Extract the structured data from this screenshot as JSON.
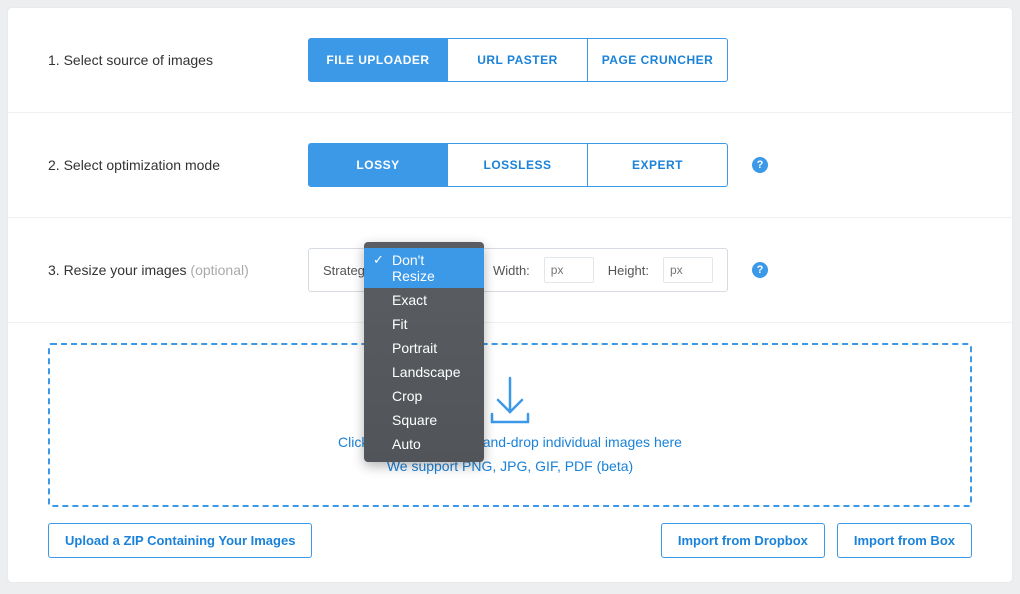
{
  "section1": {
    "label": "1. Select source of images",
    "tabs": [
      "FILE UPLOADER",
      "URL PASTER",
      "PAGE CRUNCHER"
    ],
    "active": 0
  },
  "section2": {
    "label": "2. Select optimization mode",
    "tabs": [
      "LOSSY",
      "LOSSLESS",
      "EXPERT"
    ],
    "active": 0
  },
  "section3": {
    "label": "3. Resize your images ",
    "optional": "(optional)",
    "strategy_label": "Strategy",
    "width_label": "Width:",
    "height_label": "Height:",
    "px_placeholder": "px",
    "dropdown": {
      "options": [
        "Don't Resize",
        "Exact",
        "Fit",
        "Portrait",
        "Landscape",
        "Crop",
        "Square",
        "Auto"
      ],
      "selected": 0
    }
  },
  "upload": {
    "line1": "Click to upload or drag-and-drop individual images here",
    "line2": "We support PNG, JPG, GIF, PDF (beta)"
  },
  "buttons": {
    "zip": "Upload a ZIP Containing Your Images",
    "dropbox": "Import from Dropbox",
    "box": "Import from Box"
  },
  "help_char": "?"
}
